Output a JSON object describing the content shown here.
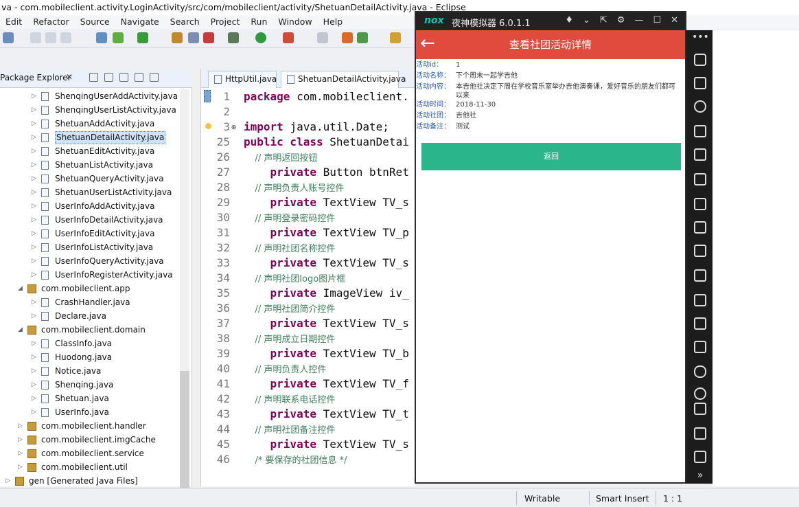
{
  "window": {
    "title": "va - com.mobileclient.activity.LoginActivity/src/com/mobileclient/activity/ShetuanDetailActivity.java - Eclipse"
  },
  "menu": [
    "Edit",
    "Refactor",
    "Source",
    "Navigate",
    "Search",
    "Project",
    "Run",
    "Window",
    "Help"
  ],
  "package_explorer": {
    "tab_label": "Package Explorer",
    "close": "✕",
    "items": [
      {
        "label": "ShenqingUserAddActivity.java",
        "kind": "file",
        "level": 2
      },
      {
        "label": "ShenqingUserListActivity.java",
        "kind": "file",
        "level": 2
      },
      {
        "label": "ShetuanAddActivity.java",
        "kind": "file",
        "level": 2
      },
      {
        "label": "ShetuanDetailActivity.java",
        "kind": "file",
        "level": 2,
        "selected": true
      },
      {
        "label": "ShetuanEditActivity.java",
        "kind": "file",
        "level": 2
      },
      {
        "label": "ShetuanListActivity.java",
        "kind": "file",
        "level": 2
      },
      {
        "label": "ShetuanQueryActivity.java",
        "kind": "file",
        "level": 2
      },
      {
        "label": "ShetuanUserListActivity.java",
        "kind": "file",
        "level": 2
      },
      {
        "label": "UserInfoAddActivity.java",
        "kind": "file",
        "level": 2
      },
      {
        "label": "UserInfoDetailActivity.java",
        "kind": "file",
        "level": 2
      },
      {
        "label": "UserInfoEditActivity.java",
        "kind": "file",
        "level": 2
      },
      {
        "label": "UserInfoListActivity.java",
        "kind": "file",
        "level": 2
      },
      {
        "label": "UserInfoQueryActivity.java",
        "kind": "file",
        "level": 2
      },
      {
        "label": "UserInfoRegisterActivity.java",
        "kind": "file",
        "level": 2
      },
      {
        "label": "com.mobileclient.app",
        "kind": "package",
        "level": 1,
        "expanded": true
      },
      {
        "label": "CrashHandler.java",
        "kind": "file",
        "level": 2
      },
      {
        "label": "Declare.java",
        "kind": "file",
        "level": 2
      },
      {
        "label": "com.mobileclient.domain",
        "kind": "package",
        "level": 1,
        "expanded": true
      },
      {
        "label": "ClassInfo.java",
        "kind": "file",
        "level": 2
      },
      {
        "label": "Huodong.java",
        "kind": "file",
        "level": 2
      },
      {
        "label": "Notice.java",
        "kind": "file",
        "level": 2
      },
      {
        "label": "Shenqing.java",
        "kind": "file",
        "level": 2
      },
      {
        "label": "Shetuan.java",
        "kind": "file",
        "level": 2
      },
      {
        "label": "UserInfo.java",
        "kind": "file",
        "level": 2
      },
      {
        "label": "com.mobileclient.handler",
        "kind": "package",
        "level": 1
      },
      {
        "label": "com.mobileclient.imgCache",
        "kind": "package",
        "level": 1
      },
      {
        "label": "com.mobileclient.service",
        "kind": "package",
        "level": 1
      },
      {
        "label": "com.mobileclient.util",
        "kind": "package",
        "level": 1
      },
      {
        "label": "gen [Generated Java Files]",
        "kind": "folder",
        "level": 0
      }
    ]
  },
  "editor": {
    "tabs": [
      {
        "label": "HttpUtil.java",
        "active": false
      },
      {
        "label": "ShetuanDetailActivity.java",
        "active": true
      }
    ],
    "lines": [
      {
        "n": "1",
        "parts": [
          {
            "t": "package ",
            "c": "kw"
          },
          {
            "t": "com.mobileclient.",
            "c": ""
          }
        ]
      },
      {
        "n": "2",
        "parts": []
      },
      {
        "n": "3",
        "marker": "⊕",
        "parts": [
          {
            "t": "import ",
            "c": "kw"
          },
          {
            "t": "java.util.Date;",
            "c": ""
          }
        ]
      },
      {
        "n": "25",
        "parts": [
          {
            "t": "public class ",
            "c": "kw"
          },
          {
            "t": "ShetuanDetai",
            "c": ""
          }
        ]
      },
      {
        "n": "26",
        "parts": [
          {
            "t": "    // 声明返回按钮",
            "c": "cm"
          }
        ]
      },
      {
        "n": "27",
        "parts": [
          {
            "t": "    private ",
            "c": "kw"
          },
          {
            "t": "Button btnRet",
            "c": ""
          }
        ]
      },
      {
        "n": "28",
        "parts": [
          {
            "t": "    // 声明负责人账号控件",
            "c": "cm"
          }
        ]
      },
      {
        "n": "29",
        "parts": [
          {
            "t": "    private ",
            "c": "kw"
          },
          {
            "t": "TextView TV_s",
            "c": ""
          }
        ]
      },
      {
        "n": "30",
        "parts": [
          {
            "t": "    // 声明登录密码控件",
            "c": "cm"
          }
        ]
      },
      {
        "n": "31",
        "parts": [
          {
            "t": "    private ",
            "c": "kw"
          },
          {
            "t": "TextView TV_p",
            "c": ""
          }
        ]
      },
      {
        "n": "32",
        "parts": [
          {
            "t": "    // 声明社团名称控件",
            "c": "cm"
          }
        ]
      },
      {
        "n": "33",
        "parts": [
          {
            "t": "    private ",
            "c": "kw"
          },
          {
            "t": "TextView TV_s",
            "c": ""
          }
        ]
      },
      {
        "n": "34",
        "parts": [
          {
            "t": "    // 声明社团logo图片框",
            "c": "cm"
          }
        ]
      },
      {
        "n": "35",
        "parts": [
          {
            "t": "    private ",
            "c": "kw"
          },
          {
            "t": "ImageView iv_",
            "c": ""
          }
        ]
      },
      {
        "n": "36",
        "parts": [
          {
            "t": "    // 声明社团简介控件",
            "c": "cm"
          }
        ]
      },
      {
        "n": "37",
        "parts": [
          {
            "t": "    private ",
            "c": "kw"
          },
          {
            "t": "TextView TV_s",
            "c": ""
          }
        ]
      },
      {
        "n": "38",
        "parts": [
          {
            "t": "    // 声明成立日期控件",
            "c": "cm"
          }
        ]
      },
      {
        "n": "39",
        "parts": [
          {
            "t": "    private ",
            "c": "kw"
          },
          {
            "t": "TextView TV_b",
            "c": ""
          }
        ]
      },
      {
        "n": "40",
        "parts": [
          {
            "t": "    // 声明负责人控件",
            "c": "cm"
          }
        ]
      },
      {
        "n": "41",
        "parts": [
          {
            "t": "    private ",
            "c": "kw"
          },
          {
            "t": "TextView TV_f",
            "c": ""
          }
        ]
      },
      {
        "n": "42",
        "parts": [
          {
            "t": "    // 声明联系电话控件",
            "c": "cm"
          }
        ]
      },
      {
        "n": "43",
        "parts": [
          {
            "t": "    private ",
            "c": "kw"
          },
          {
            "t": "TextView TV_t",
            "c": ""
          }
        ]
      },
      {
        "n": "44",
        "parts": [
          {
            "t": "    // 声明社团备注控件",
            "c": "cm"
          }
        ]
      },
      {
        "n": "45",
        "parts": [
          {
            "t": "    private ",
            "c": "kw"
          },
          {
            "t": "TextView TV_s",
            "c": ""
          }
        ]
      },
      {
        "n": "46",
        "parts": [
          {
            "t": "    /* 要保存的社团信息 */",
            "c": "cm"
          }
        ]
      }
    ]
  },
  "emulator": {
    "logo": "nox",
    "name": "夜神模拟器 6.0.1.1",
    "controls": [
      "♦",
      "⌄",
      "⇱",
      "⚙",
      "—",
      "☐",
      "✕"
    ],
    "app_title": "查看社团活动详情",
    "back": "←",
    "fields": [
      {
        "label": "活动id：",
        "value": "1"
      },
      {
        "label": "活动名称：",
        "value": "下个周末一起学吉他"
      },
      {
        "label": "活动内容：",
        "value": "本吉他社决定下周在学校音乐室举办吉他演奏课，爱好音乐的朋友们都可以来"
      },
      {
        "label": "活动时间：",
        "value": "2018-11-30"
      },
      {
        "label": "活动社团：",
        "value": "吉他社"
      },
      {
        "label": "活动备注：",
        "value": "测试"
      }
    ],
    "return_button": "返回",
    "sidebar_top": "•••",
    "sidebar_bottom": "»"
  },
  "statusbar": {
    "writable": "Writable",
    "insert": "Smart Insert",
    "position": "1 : 1"
  }
}
